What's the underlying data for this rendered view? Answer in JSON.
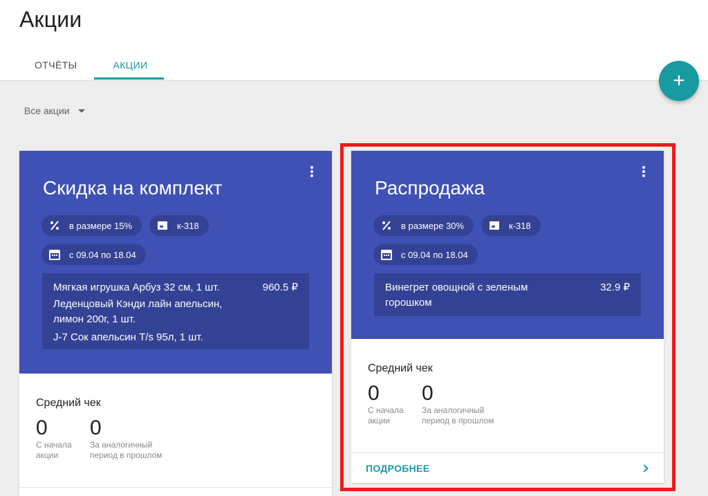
{
  "page": {
    "title": "Акции"
  },
  "tabs": [
    {
      "label": "ОТЧЁТЫ",
      "active": false
    },
    {
      "label": "АКЦИИ",
      "active": true
    }
  ],
  "fab": {
    "label": "+",
    "icon": "add-icon"
  },
  "filter": {
    "label": "Все акции",
    "icon": "dropdown-caret-icon"
  },
  "colors": {
    "accent": "#179aa0",
    "card_header": "#3f51b5",
    "highlight": "#ef1a1a"
  },
  "cards": [
    {
      "title": "Скидка на комплект",
      "chips": {
        "discount": "в размере 15%",
        "store": "к-318",
        "dates": "с 09.04 по 18.04"
      },
      "products": [
        {
          "name": "Мягкая игрушка Арбуз 32 см, 1 шт.",
          "price": "960.5 ₽"
        },
        {
          "name": "Леденцовый Кэнди лайн апельсин,\nлимон 200г, 1 шт.",
          "price": ""
        },
        {
          "name": "J-7 Сок апельсин T/s 95л, 1 шт.",
          "price": ""
        }
      ],
      "stats": {
        "label": "Средний чек",
        "since_start": {
          "value": "0",
          "caption": "С начала\nакции"
        },
        "prev_period": {
          "value": "0",
          "caption": "За аналогичный\nпериод в прошлом"
        }
      }
    },
    {
      "title": "Распродажа",
      "chips": {
        "discount": "в размере 30%",
        "store": "к-318",
        "dates": "с 09.04 по 18.04"
      },
      "products": [
        {
          "name": "Винегрет овощной с зеленым\nгорошком",
          "price": "32.9 ₽"
        }
      ],
      "stats": {
        "label": "Средний чек",
        "since_start": {
          "value": "0",
          "caption": "С начала\nакции"
        },
        "prev_period": {
          "value": "0",
          "caption": "За аналогичный\nпериод в прошлом"
        }
      },
      "footer": {
        "link": "ПОДРОБНЕЕ"
      }
    }
  ]
}
